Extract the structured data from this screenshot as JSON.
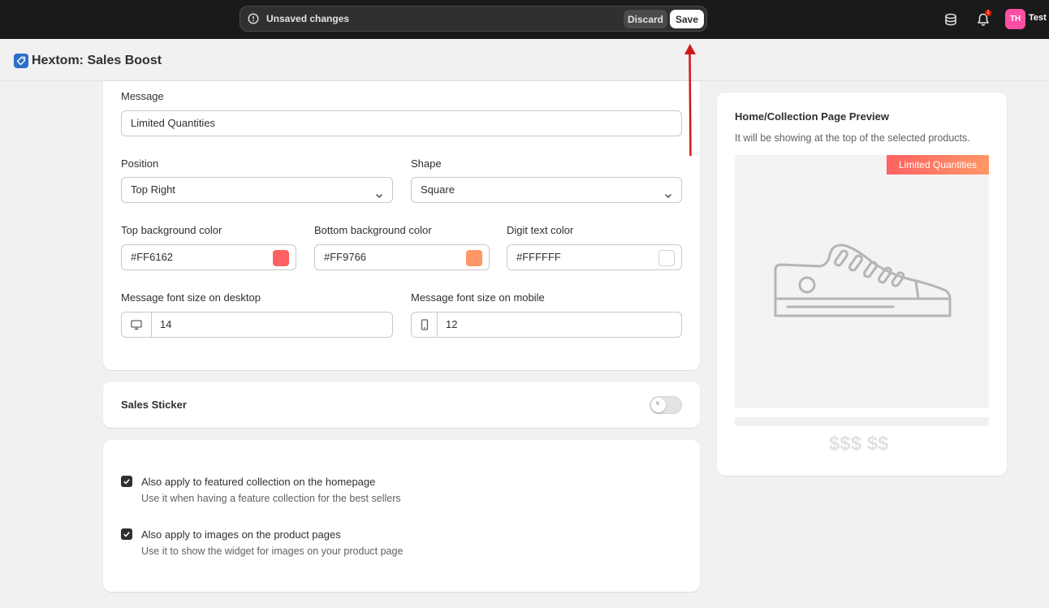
{
  "topbar": {
    "unsaved_text": "Unsaved changes",
    "discard_label": "Discard",
    "save_label": "Save",
    "notification_count": "1",
    "avatar_initials": "TH",
    "user_name": "Test"
  },
  "app": {
    "title": "Hextom: Sales Boost"
  },
  "settings": {
    "message_label": "Message",
    "message_value": "Limited Quantities",
    "position_label": "Position",
    "position_value": "Top Right",
    "shape_label": "Shape",
    "shape_value": "Square",
    "top_bg_label": "Top background color",
    "top_bg_value": "#FF6162",
    "bottom_bg_label": "Bottom background color",
    "bottom_bg_value": "#FF9766",
    "digit_color_label": "Digit text color",
    "digit_color_value": "#FFFFFF",
    "font_desktop_label": "Message font size on desktop",
    "font_desktop_value": "14",
    "font_mobile_label": "Message font size on mobile",
    "font_mobile_value": "12"
  },
  "sticker": {
    "title": "Sales Sticker",
    "toggle_on": false
  },
  "options": [
    {
      "label": "Also apply to featured collection on the homepage",
      "help": "Use it when having a feature collection for the best sellers",
      "checked": true
    },
    {
      "label": "Also apply to images on the product pages",
      "help": "Use it to show the widget for images on your product page",
      "checked": true
    }
  ],
  "preview": {
    "title": "Home/Collection Page Preview",
    "subtitle": "It will be showing at the top of the selected products.",
    "badge_text": "Limited Quantities",
    "price_text": "$$$ $$"
  },
  "colors": {
    "top_bg": "#FF6162",
    "bottom_bg": "#FF9766",
    "digit_text": "#FFFFFF",
    "annotation_arrow": "#d0181b"
  }
}
